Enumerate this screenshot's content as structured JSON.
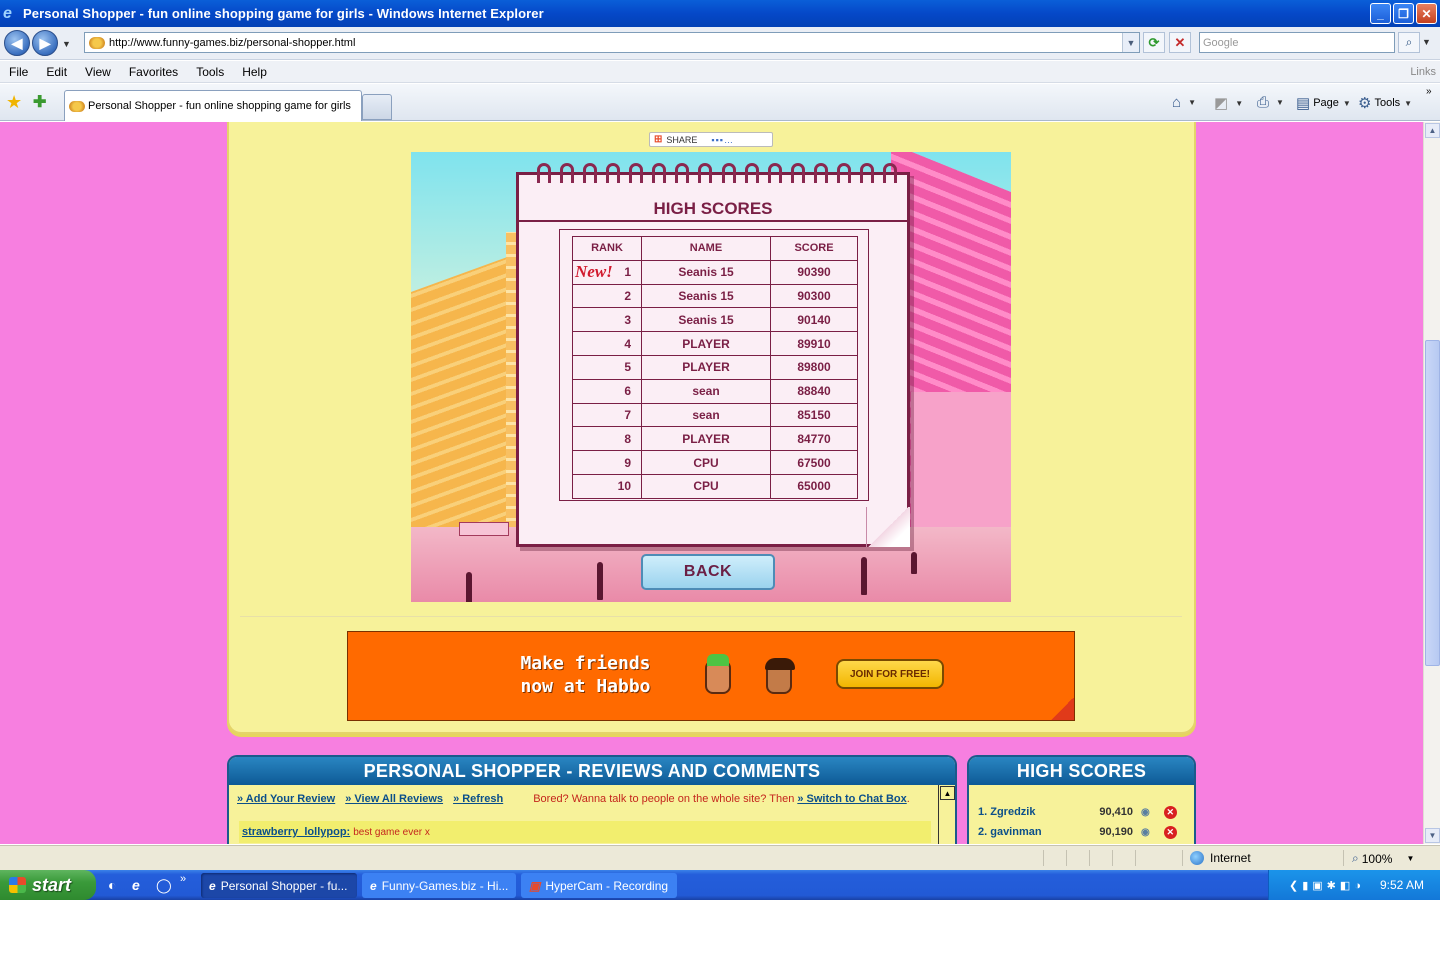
{
  "window": {
    "title": "Personal Shopper - fun online shopping game for girls - Windows Internet Explorer"
  },
  "address": {
    "url": "http://www.funny-games.biz/personal-shopper.html",
    "search_placeholder": "Google"
  },
  "menu": [
    "File",
    "Edit",
    "View",
    "Favorites",
    "Tools",
    "Help"
  ],
  "menu_links": "Links",
  "tab": {
    "label": "Personal Shopper - fun online shopping game for girls"
  },
  "commands": {
    "page": "Page",
    "tools": "Tools"
  },
  "share": {
    "label": "SHARE"
  },
  "game": {
    "title": "HIGH SCORES",
    "headers": {
      "rank": "RANK",
      "name": "NAME",
      "score": "SCORE"
    },
    "new_tag": "New!",
    "rows": [
      {
        "rank": "1",
        "name": "Seanis 15",
        "score": "90390"
      },
      {
        "rank": "2",
        "name": "Seanis 15",
        "score": "90300"
      },
      {
        "rank": "3",
        "name": "Seanis 15",
        "score": "90140"
      },
      {
        "rank": "4",
        "name": "PLAYER",
        "score": "89910"
      },
      {
        "rank": "5",
        "name": "PLAYER",
        "score": "89800"
      },
      {
        "rank": "6",
        "name": "sean",
        "score": "88840"
      },
      {
        "rank": "7",
        "name": "sean",
        "score": "85150"
      },
      {
        "rank": "8",
        "name": "PLAYER",
        "score": "84770"
      },
      {
        "rank": "9",
        "name": "CPU",
        "score": "67500"
      },
      {
        "rank": "10",
        "name": "CPU",
        "score": "65000"
      }
    ],
    "back_label": "BACK"
  },
  "ad": {
    "text": "Make friends\nnow at Habbo",
    "button": "JOIN FOR FREE!"
  },
  "reviews": {
    "title": "PERSONAL SHOPPER - REVIEWS AND COMMENTS",
    "add": "» Add Your Review",
    "view_all": "» View All Reviews",
    "refresh": "» Refresh",
    "bored": "Bored? Wanna talk to people on the whole site? Then",
    "chat": "» Switch to Chat Box",
    "chat_suffix": ".",
    "comment_user": "strawberry_lollypop:",
    "comment_text": "best game ever x"
  },
  "site_highscores": {
    "title": "HIGH SCORES",
    "rows": [
      {
        "who": "1. Zgredzik",
        "pts": "90,410"
      },
      {
        "who": "2. gavinman",
        "pts": "90,190"
      }
    ]
  },
  "status": {
    "zone": "Internet",
    "zoom": "100%"
  },
  "taskbar": {
    "start": "start",
    "items": [
      "Personal Shopper - fu...",
      "Funny-Games.biz - Hi...",
      "HyperCam - Recording"
    ],
    "clock": "9:52 AM"
  },
  "colors": {
    "page_bg": "#f77fe0",
    "card_bg": "#f7f29a",
    "panel_header": "#0d5a96",
    "score_text": "#7a1f45",
    "ad_bg": "#ff6a00"
  }
}
